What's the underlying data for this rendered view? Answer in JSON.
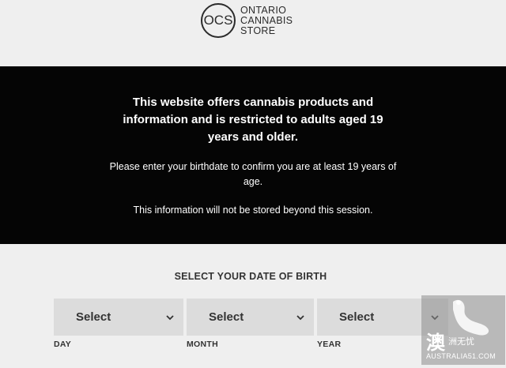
{
  "header": {
    "logo_mark": "OCS",
    "logo_lines": [
      "ONTARIO",
      "CANNABIS",
      "STORE"
    ]
  },
  "banner": {
    "heading": "This website offers cannabis products and information and is restricted to adults aged 19 years and older.",
    "line1": "Please enter your birthdate to confirm you are at least 19 years of age.",
    "line2": "This information will not be stored beyond this session."
  },
  "dob": {
    "title": "SELECT YOUR DATE OF BIRTH",
    "fields": [
      {
        "value": "Select",
        "label": "DAY"
      },
      {
        "value": "Select",
        "label": "MONTH"
      },
      {
        "value": "Select",
        "label": "YEAR"
      }
    ]
  },
  "watermark": {
    "glyph": "澳",
    "cn_text": "洲无忧",
    "url": "AUSTRALIA51.COM"
  }
}
